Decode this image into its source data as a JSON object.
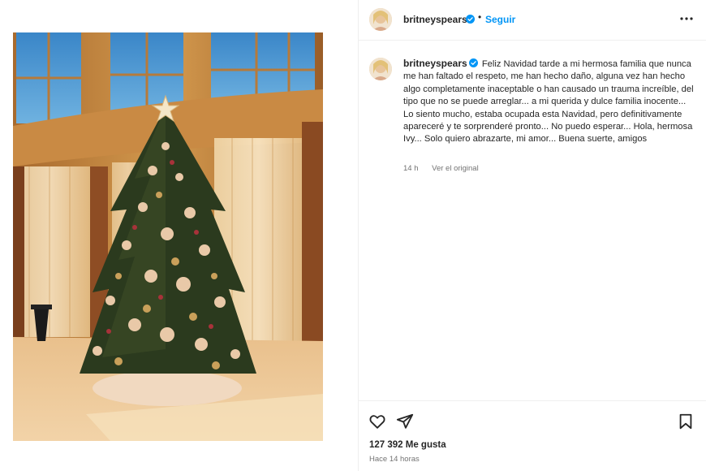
{
  "post": {
    "username": "britneyspears",
    "follow_label": "Seguir",
    "separator": "•",
    "caption": "Feliz Navidad tarde a mi hermosa familia que nunca me han faltado el respeto, me han hecho daño, alguna vez han hecho algo completamente inaceptable o han causado un trauma increíble, del tipo que no se puede arreglar... a mi querida y dulce familia inocente... Lo siento mucho, estaba ocupada esta Navidad, pero definitivamente apareceré y te sorprenderé pronto... No puedo esperar... Hola, hermosa Ivy... Solo quiero abrazarte, mi amor... Buena suerte, amigos",
    "age": "14 h",
    "see_original": "Ver el original",
    "likes": "127 392 Me gusta",
    "time_ago": "Hace 14 horas"
  },
  "icons": {
    "verified": "verified-badge-icon",
    "more": "more-options-icon",
    "like": "heart-icon",
    "share": "paper-plane-icon",
    "save": "bookmark-icon"
  },
  "colors": {
    "accent": "#0095f6",
    "text": "#262626",
    "muted": "#737373",
    "verified": "#0095f6"
  }
}
